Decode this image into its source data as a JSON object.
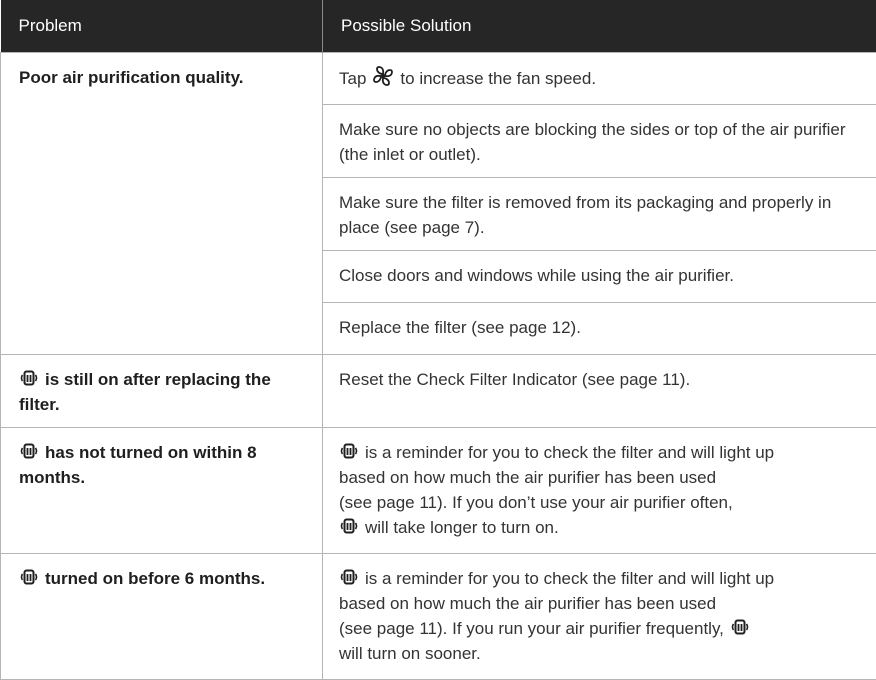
{
  "header": {
    "problem": "Problem",
    "solution": "Possible Solution"
  },
  "rows": [
    {
      "problem": "Poor air purification quality.",
      "solutions": [
        {
          "before": "Tap",
          "icon": "fan-icon",
          "after": "to increase the fan speed."
        },
        {
          "text": "Make sure no objects are blocking the sides or top of the air purifier (the inlet or outlet)."
        },
        {
          "text": "Make sure the filter is removed from its packaging and properly in place (see page 7)."
        },
        {
          "text": "Close doors and windows while using the air purifier."
        },
        {
          "text": "Replace the filter (see page 12)."
        }
      ]
    },
    {
      "problem_icon": "check-filter-icon",
      "problem": "is still on after replacing the filter.",
      "solution": "Reset the Check Filter Indicator (see page 11)."
    },
    {
      "problem_icon": "check-filter-icon",
      "problem": "has not turned on within 8 months.",
      "solution_icon": "check-filter-icon",
      "solution_lines": [
        "is a reminder for you to check the filter and will light up",
        "based on how much the air purifier has been used",
        "(see page 11). If you don’t use your air purifier often,",
        "will take longer to turn on."
      ]
    },
    {
      "problem_icon": "check-filter-icon",
      "problem": "turned on before 6 months.",
      "solution_icon": "check-filter-icon",
      "solution_lines": [
        "is a reminder for you to check the filter and will light up",
        "based on how much the air purifier has been used",
        "(see page 11). If you run your air purifier frequently,",
        "will turn on sooner."
      ]
    }
  ]
}
